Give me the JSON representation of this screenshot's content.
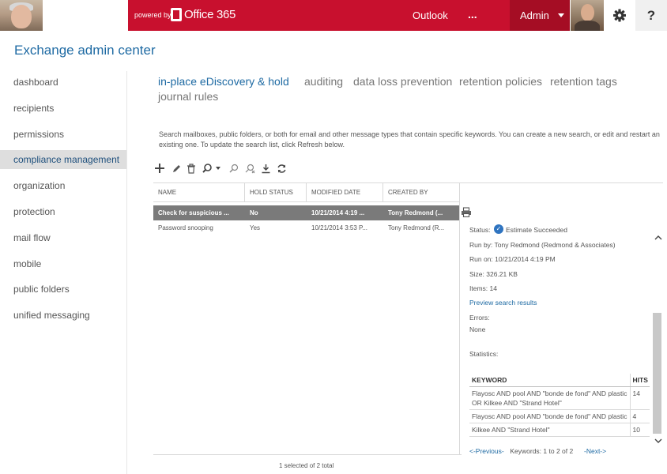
{
  "topbar": {
    "powered_by": "powered by",
    "brand": "Office 365",
    "nav_outlook": "Outlook",
    "nav_more": "...",
    "admin": "Admin",
    "help": "?"
  },
  "app_title": "Exchange admin center",
  "left_nav": [
    "dashboard",
    "recipients",
    "permissions",
    "compliance management",
    "organization",
    "protection",
    "mail flow",
    "mobile",
    "public folders",
    "unified messaging"
  ],
  "selected_nav": "compliance management",
  "tabs": [
    "in-place eDiscovery & hold",
    "auditing",
    "data loss prevention",
    "retention policies",
    "retention tags",
    "journal rules"
  ],
  "description": "Search mailboxes, public folders, or both for email and other message types that contain specific keywords. You can create a new search, or edit and restart an existing one. To update the search list, click Refresh below.",
  "toolbar_icons": [
    "add-icon",
    "edit-icon",
    "delete-icon",
    "search-icon",
    "search-start-icon",
    "search-stop-icon",
    "export-icon",
    "refresh-icon"
  ],
  "list": {
    "columns": [
      "NAME",
      "HOLD STATUS",
      "MODIFIED DATE",
      "CREATED BY"
    ],
    "rows": [
      [
        "Check for suspicious ...",
        "No",
        "10/21/2014 4:19 ...",
        "Tony Redmond (..."
      ],
      [
        "Password snooping",
        "Yes",
        "10/21/2014 3:53 P...",
        "Tony Redmond (R..."
      ]
    ],
    "footer": "1 selected of 2 total"
  },
  "details": {
    "status_label": "Status:",
    "status_value": "Estimate Succeeded",
    "run_by": "Run by: Tony Redmond (Redmond & Associates)",
    "run_on": "Run on: 10/21/2014 4:19 PM",
    "size": "Size: 326.21 KB",
    "items": "Items: 14",
    "preview_link": "Preview search results",
    "errors_label": "Errors:",
    "errors_value": "None",
    "statistics_label": "Statistics:",
    "keyword_header": "KEYWORD",
    "hits_header": "HITS",
    "keywords": [
      {
        "keyword": "Flayosc AND pool AND \"bonde de fond\" AND plastic OR Kilkee AND \"Strand Hotel\"",
        "hits": "14"
      },
      {
        "keyword": "Flayosc AND pool AND \"bonde de fond\" AND plastic",
        "hits": "4"
      },
      {
        "keyword": "Kilkee AND \"Strand Hotel\"",
        "hits": "10"
      }
    ],
    "pager": {
      "prev": "<-Previous-",
      "middle": " Keywords: 1 to 2 of 2 ",
      "next": "-Next->"
    }
  }
}
